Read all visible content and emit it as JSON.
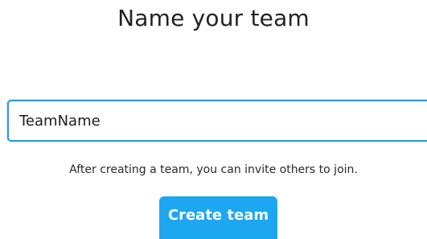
{
  "title": "Name your team",
  "team_input": {
    "value": "TeamName"
  },
  "hint": "After creating a team, you can invite others to join.",
  "create_button": {
    "label": "Create team"
  },
  "colors": {
    "accent": "#1ea7f1",
    "input_border": "#2f9bdc"
  }
}
